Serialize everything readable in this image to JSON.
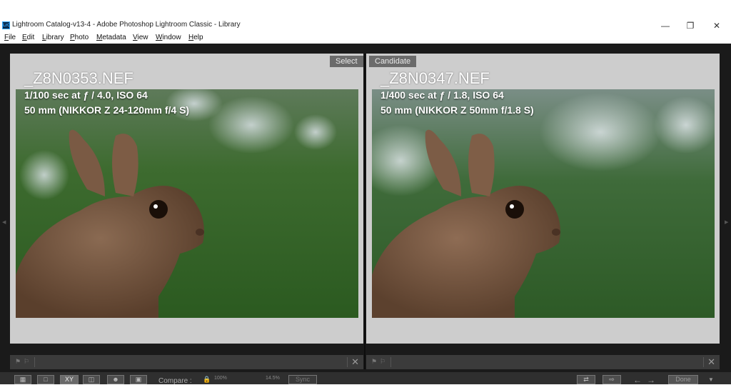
{
  "window": {
    "icon_label": "LrC",
    "title": "Lightroom Catalog-v13-4 - Adobe Photoshop Lightroom Classic - Library",
    "minimize": "—",
    "restore": "❐",
    "close": "✕"
  },
  "menu": [
    {
      "label": "File",
      "underline": "F"
    },
    {
      "label": "Edit",
      "underline": "E"
    },
    {
      "label": "Library",
      "underline": "L"
    },
    {
      "label": "Photo",
      "underline": "P"
    },
    {
      "label": "Metadata",
      "underline": "M"
    },
    {
      "label": "View",
      "underline": "V"
    },
    {
      "label": "Window",
      "underline": "W"
    },
    {
      "label": "Help",
      "underline": "H"
    }
  ],
  "compare": {
    "select": {
      "badge": "Select",
      "filename": "_Z8N0353.NEF",
      "exposure": "1/100 sec at ƒ / 4.0, ISO 64",
      "lens": "50 mm (NIKKOR Z 24-120mm f/4 S)"
    },
    "candidate": {
      "badge": "Candidate",
      "filename": "_Z8N0347.NEF",
      "exposure": "1/400 sec at ƒ / 1.8, ISO 64",
      "lens": "50 mm (NIKKOR Z 50mm f/1.8 S)"
    }
  },
  "toolbar": {
    "compare_label": "Compare :",
    "zoom_100": "100%",
    "zoom_fit": "14.5%",
    "sync_label": "Sync",
    "xy_label": "XY",
    "done_label": "Done"
  },
  "icons": {
    "grid": "grid-view-icon",
    "loupe": "loupe-view-icon",
    "compare": "compare-view-icon",
    "survey": "survey-view-icon",
    "people": "people-view-icon",
    "slideshow": "impromptu-slideshow-icon",
    "lock": "lock-icon",
    "swap": "swap-icon",
    "make_select": "make-select-icon",
    "prev": "arrow-left-icon",
    "next": "arrow-right-icon",
    "flag_pick": "flag-pick-icon",
    "flag_reject": "flag-reject-icon",
    "close": "close-icon"
  },
  "colors": {
    "pane_bg": "#cdcdcd",
    "workarea_bg": "#1a1a1a",
    "badge_bg": "#6b6b6b"
  }
}
